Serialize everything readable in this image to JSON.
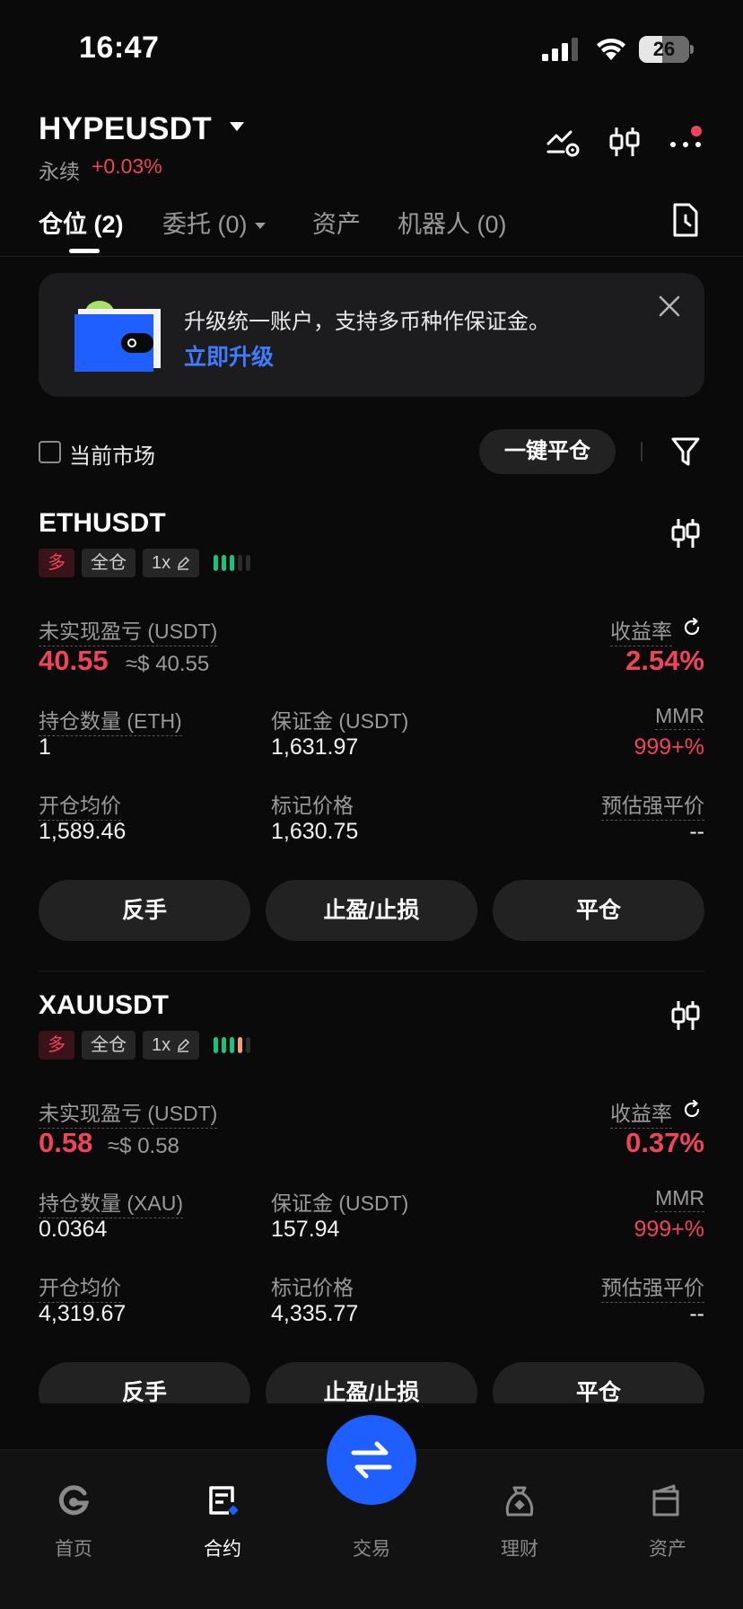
{
  "status": {
    "time": "16:47",
    "battery": "26"
  },
  "header": {
    "pair": "HYPEUSDT",
    "type": "永续",
    "change": "+0.03%"
  },
  "tabs": [
    {
      "label": "仓位 (2)",
      "active": true
    },
    {
      "label": "委托 (0)",
      "active": false
    },
    {
      "label": "资产",
      "active": false
    },
    {
      "label": "机器人 (0)",
      "active": false
    }
  ],
  "banner": {
    "text": "升级统一账户，支持多币种作保证金。",
    "link": "立即升级"
  },
  "filter": {
    "checkbox_label": "当前市场",
    "close_all": "一键平仓"
  },
  "positions": [
    {
      "symbol": "ETHUSDT",
      "side": "多",
      "margin_mode": "全仓",
      "leverage": "1x",
      "pnl_label": "未实现盈亏 (USDT)",
      "pnl": "40.55",
      "pnl_usd": "≈$ 40.55",
      "roe_label": "收益率",
      "roe": "2.54%",
      "qty_label": "持仓数量 (ETH)",
      "qty": "1",
      "margin_label": "保证金 (USDT)",
      "margin": "1,631.97",
      "mmr_label": "MMR",
      "mmr": "999+%",
      "entry_label": "开仓均价",
      "entry": "1,589.46",
      "mark_label": "标记价格",
      "mark": "1,630.75",
      "liq_label": "预估强平价",
      "liq": "--",
      "buttons": [
        "反手",
        "止盈/止损",
        "平仓"
      ]
    },
    {
      "symbol": "XAUUSDT",
      "side": "多",
      "margin_mode": "全仓",
      "leverage": "1x",
      "pnl_label": "未实现盈亏 (USDT)",
      "pnl": "0.58",
      "pnl_usd": "≈$ 0.58",
      "roe_label": "收益率",
      "roe": "0.37%",
      "qty_label": "持仓数量 (XAU)",
      "qty": "0.0364",
      "margin_label": "保证金 (USDT)",
      "margin": "157.94",
      "mmr_label": "MMR",
      "mmr": "999+%",
      "entry_label": "开仓均价",
      "entry": "4,319.67",
      "mark_label": "标记价格",
      "mark": "4,335.77",
      "liq_label": "预估强平价",
      "liq": "--",
      "buttons": [
        "反手",
        "止盈/止损",
        "平仓"
      ]
    }
  ],
  "nav": [
    {
      "label": "首页",
      "icon": "home-icon"
    },
    {
      "label": "合约",
      "icon": "contract-icon",
      "active": true
    },
    {
      "label": "交易",
      "icon": "swap-icon"
    },
    {
      "label": "理财",
      "icon": "earn-icon"
    },
    {
      "label": "资产",
      "icon": "wallet-icon"
    }
  ],
  "colors": {
    "accent": "#1f5eff",
    "down_red": "#f0435c",
    "link": "#3f7cff",
    "green": "#19c37d",
    "orange": "#f5a06b"
  }
}
